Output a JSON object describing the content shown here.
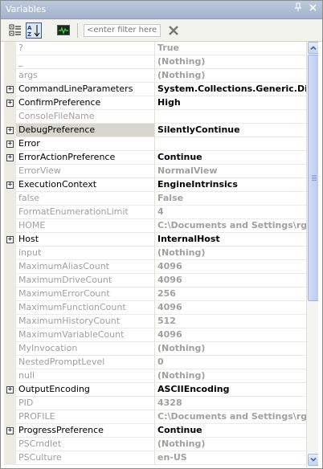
{
  "window": {
    "title": "Variables",
    "pin_glyph": "∂",
    "close_glyph": "×"
  },
  "toolbar": {
    "filter_placeholder": "<enter filter here>"
  },
  "rows": [
    {
      "name": "?",
      "value": "True",
      "expandable": false,
      "readonly": true
    },
    {
      "name": "_",
      "value": "(Nothing)",
      "expandable": false,
      "readonly": true
    },
    {
      "name": "args",
      "value": "(Nothing)",
      "expandable": false,
      "readonly": true
    },
    {
      "name": "CommandLineParameters",
      "value": "System.Collections.Generic.Dictio",
      "expandable": true,
      "readonly": false
    },
    {
      "name": "ConfirmPreference",
      "value": "High",
      "expandable": true,
      "readonly": false
    },
    {
      "name": "ConsoleFileName",
      "value": "",
      "expandable": false,
      "readonly": true
    },
    {
      "name": "DebugPreference",
      "value": "SilentlyContinue",
      "expandable": true,
      "readonly": false,
      "selected": true
    },
    {
      "name": "Error",
      "value": "",
      "expandable": true,
      "readonly": false
    },
    {
      "name": "ErrorActionPreference",
      "value": "Continue",
      "expandable": true,
      "readonly": false
    },
    {
      "name": "ErrorView",
      "value": "NormalView",
      "expandable": false,
      "readonly": true
    },
    {
      "name": "ExecutionContext",
      "value": "EngineIntrinsics",
      "expandable": true,
      "readonly": false
    },
    {
      "name": "false",
      "value": "False",
      "expandable": false,
      "readonly": true
    },
    {
      "name": "FormatEnumerationLimit",
      "value": "4",
      "expandable": false,
      "readonly": true
    },
    {
      "name": "HOME",
      "value": "C:\\Documents and Settings\\rgile",
      "expandable": false,
      "readonly": true
    },
    {
      "name": "Host",
      "value": "InternalHost",
      "expandable": true,
      "readonly": false
    },
    {
      "name": "input",
      "value": "(Nothing)",
      "expandable": false,
      "readonly": true
    },
    {
      "name": "MaximumAliasCount",
      "value": "4096",
      "expandable": false,
      "readonly": true
    },
    {
      "name": "MaximumDriveCount",
      "value": "4096",
      "expandable": false,
      "readonly": true
    },
    {
      "name": "MaximumErrorCount",
      "value": "256",
      "expandable": false,
      "readonly": true
    },
    {
      "name": "MaximumFunctionCount",
      "value": "4096",
      "expandable": false,
      "readonly": true
    },
    {
      "name": "MaximumHistoryCount",
      "value": "512",
      "expandable": false,
      "readonly": true
    },
    {
      "name": "MaximumVariableCount",
      "value": "4096",
      "expandable": false,
      "readonly": true
    },
    {
      "name": "MyInvocation",
      "value": "(Nothing)",
      "expandable": false,
      "readonly": true
    },
    {
      "name": "NestedPromptLevel",
      "value": "0",
      "expandable": false,
      "readonly": true
    },
    {
      "name": "null",
      "value": "(Nothing)",
      "expandable": false,
      "readonly": true
    },
    {
      "name": "OutputEncoding",
      "value": "ASCIIEncoding",
      "expandable": true,
      "readonly": false
    },
    {
      "name": "PID",
      "value": "4328",
      "expandable": false,
      "readonly": true
    },
    {
      "name": "PROFILE",
      "value": "C:\\Documents and Settings\\rgile",
      "expandable": false,
      "readonly": true
    },
    {
      "name": "ProgressPreference",
      "value": "Continue",
      "expandable": true,
      "readonly": false
    },
    {
      "name": "PSCmdlet",
      "value": "(Nothing)",
      "expandable": false,
      "readonly": true
    },
    {
      "name": "PSCulture",
      "value": "en-US",
      "expandable": false,
      "readonly": true
    }
  ],
  "colors": {
    "readonly_text": "#a0a0a0",
    "title_bar": "#a4b4cc",
    "toolbar_bg": "#f3f3ee"
  }
}
